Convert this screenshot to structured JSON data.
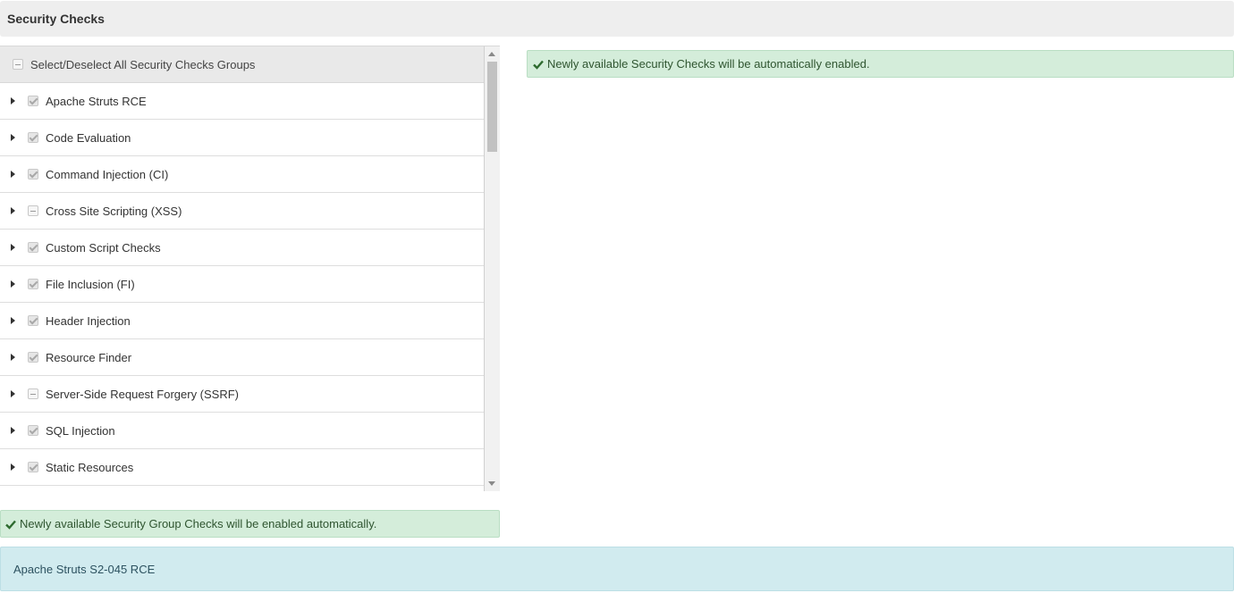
{
  "header": {
    "title": "Security Checks"
  },
  "list": {
    "select_all_label": "Select/Deselect All Security Checks Groups",
    "items": [
      {
        "label": "Apache Struts RCE",
        "state": "checked"
      },
      {
        "label": "Code Evaluation",
        "state": "checked"
      },
      {
        "label": "Command Injection (CI)",
        "state": "checked"
      },
      {
        "label": "Cross Site Scripting (XSS)",
        "state": "partial"
      },
      {
        "label": "Custom Script Checks",
        "state": "checked"
      },
      {
        "label": "File Inclusion (FI)",
        "state": "checked"
      },
      {
        "label": "Header Injection",
        "state": "checked"
      },
      {
        "label": "Resource Finder",
        "state": "checked"
      },
      {
        "label": "Server-Side Request Forgery (SSRF)",
        "state": "partial"
      },
      {
        "label": "SQL Injection",
        "state": "checked"
      },
      {
        "label": "Static Resources",
        "state": "checked"
      }
    ]
  },
  "notices": {
    "checks_auto": "Newly available Security Checks will be automatically enabled.",
    "groups_auto": "Newly available Security Group Checks will be enabled automatically."
  },
  "info_bar": {
    "text": "Apache Struts S2-045 RCE"
  },
  "icons": {
    "check": "check-icon",
    "caret": "caret-right-icon"
  },
  "colors": {
    "success_bg": "#d4edda",
    "info_bg": "#d1ebef",
    "check_green": "#2e6b2f"
  }
}
